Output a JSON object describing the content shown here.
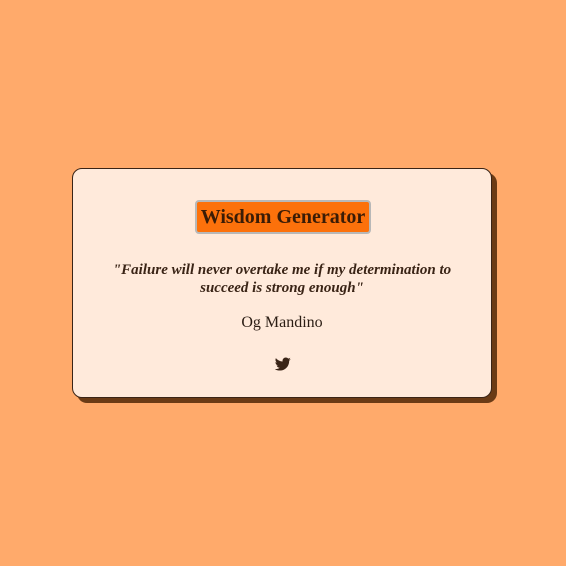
{
  "page": {
    "background_color": "#ffaa6b"
  },
  "card": {
    "background_color": "#ffeadb",
    "shadow_color": "#6b3b15",
    "generate_button_label": "Wisdom Generator",
    "generate_button_color": "#fc710b",
    "quote_text": "\"Failure will never overtake me if my determination to succeed is strong enough\"",
    "author": "Og Mandino",
    "share_icon": "twitter-icon"
  }
}
